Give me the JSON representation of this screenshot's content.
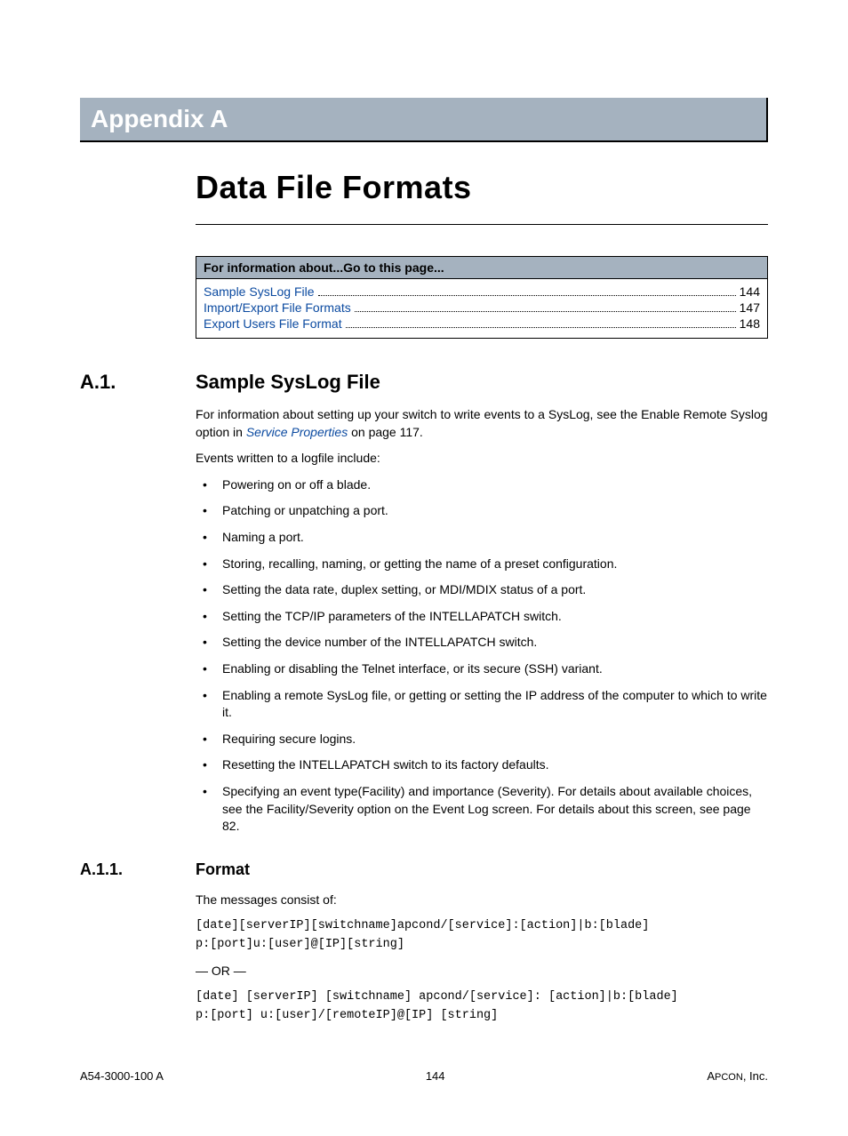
{
  "appendix_label": "Appendix A",
  "main_title": "Data File Formats",
  "toc": {
    "header": "For information about...Go to this page...",
    "items": [
      {
        "label": "Sample SysLog File",
        "page": "144"
      },
      {
        "label": "Import/Export File Formats",
        "page": "147"
      },
      {
        "label": "Export Users File Format",
        "page": "148"
      }
    ]
  },
  "section_a1": {
    "num": "A.1.",
    "title": "Sample SysLog File",
    "intro_before_link": "For information about setting up your switch to write events to a SysLog, see the Enable Remote Syslog option in ",
    "intro_link": "Service Properties",
    "intro_after_link": " on page 117.",
    "events_intro": "Events written to a logfile include:",
    "bullets": [
      "Powering on or off a blade.",
      "Patching or unpatching a port.",
      "Naming a port.",
      "Storing, recalling, naming, or getting the name of a preset configuration.",
      "Setting the data rate, duplex setting, or MDI/MDIX status of a port.",
      "Setting the TCP/IP parameters of the INTELLAPATCH switch.",
      "Setting the device number of the INTELLAPATCH switch.",
      "Enabling or disabling the Telnet interface, or its secure (SSH) variant.",
      "Enabling a remote SysLog file, or getting or setting the IP address of the computer to which to write it.",
      "Requiring secure logins.",
      "Resetting the INTELLAPATCH switch to its factory defaults.",
      "Specifying an event type(Facility) and importance (Severity). For details about available choices, see the Facility/Severity option on the Event Log screen. For details about this screen, see page 82."
    ]
  },
  "section_a11": {
    "num": "A.1.1.",
    "title": "Format",
    "msg_intro": "The messages consist of:",
    "code1": "[date][serverIP][switchname]apcond/[service]:[action]|b:[blade]\np:[port]u:[user]@[IP][string]",
    "or_text": "— OR —",
    "code2": "[date] [serverIP] [switchname] apcond/[service]: [action]|b:[blade]\np:[port] u:[user]/[remoteIP]@[IP] [string]"
  },
  "footer": {
    "left": "A54-3000-100 A",
    "center": "144",
    "right_prefix": "A",
    "right_smallcaps": "PCON",
    "right_suffix": ", Inc."
  }
}
